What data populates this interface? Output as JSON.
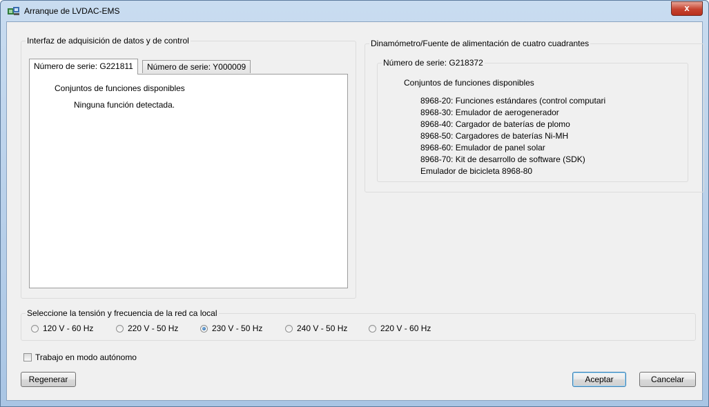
{
  "window": {
    "title": "Arranque de LVDAC-EMS",
    "close_glyph": "x",
    "icon": "app-icon"
  },
  "left_group": {
    "label": "Interfaz de adquisición de datos y de control",
    "tabs": [
      {
        "label": "Número de serie: G221811"
      },
      {
        "label": "Número de serie: Y000009"
      }
    ],
    "panel": {
      "heading": "Conjuntos de funciones disponibles",
      "message": "Ninguna función detectada."
    }
  },
  "right_group": {
    "label": "Dinamómetro/Fuente de alimentación de cuatro cuadrantes",
    "serial": "Número de serie: G218372",
    "heading": "Conjuntos de funciones disponibles",
    "functions": [
      "8968-20: Funciones estándares (control computari",
      "8968-30: Emulador de aerogenerador",
      "8968-40: Cargador de baterías de plomo",
      "8968-50: Cargadores de baterías Ni-MH",
      "8968-60: Emulador de panel solar",
      "8968-70: Kit de desarrollo de software (SDK)",
      "Emulador de bicicleta 8968-80"
    ]
  },
  "voltage_group": {
    "label": "Seleccione la tensión y frecuencia de la red ca local",
    "options": [
      {
        "label": "120 V - 60 Hz",
        "selected": false
      },
      {
        "label": "220 V - 50 Hz",
        "selected": false
      },
      {
        "label": "230 V - 50 Hz",
        "selected": true
      },
      {
        "label": "240 V - 50 Hz",
        "selected": false
      },
      {
        "label": "220 V - 60 Hz",
        "selected": false
      }
    ]
  },
  "standalone": {
    "label": "Trabajo en modo autónomo",
    "checked": false
  },
  "buttons": {
    "regenerate": "Regenerar",
    "accept": "Aceptar",
    "cancel": "Cancelar"
  }
}
